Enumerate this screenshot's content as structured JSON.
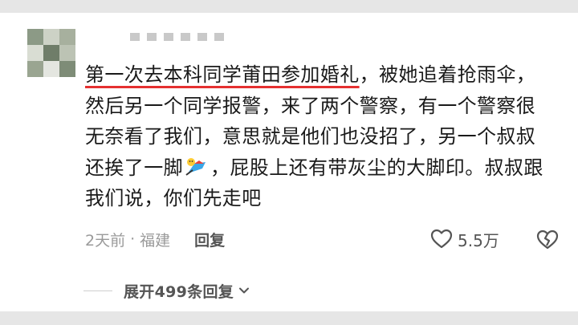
{
  "comment": {
    "underlined_text": "第一次去本科同学莆田参加婚礼",
    "text_after_underline": "，被她追着抢雨伞，然后另一个同学报警，来了两个警察，有一个警察很无奈看了我们，意思就是他们也没招了，另一个叔叔还挨了一脚",
    "emoji": "running-kick-emoji",
    "text_after_emoji": "，屁股上还有带灰尘的大脚印。叔叔跟我们说，你们先走吧"
  },
  "meta": {
    "time": "2天前",
    "separator": "·",
    "location": "福建",
    "reply_label": "回复"
  },
  "actions": {
    "like_icon": "heart-outline-icon",
    "like_count": "5.5万",
    "dislike_icon": "broken-heart-icon"
  },
  "expand": {
    "label": "展开499条回复",
    "icon": "chevron-down-icon"
  },
  "colors": {
    "underline_accent": "#e53030",
    "text": "#1a1a1a",
    "muted": "#9a9a9a",
    "background": "#ffffff"
  }
}
